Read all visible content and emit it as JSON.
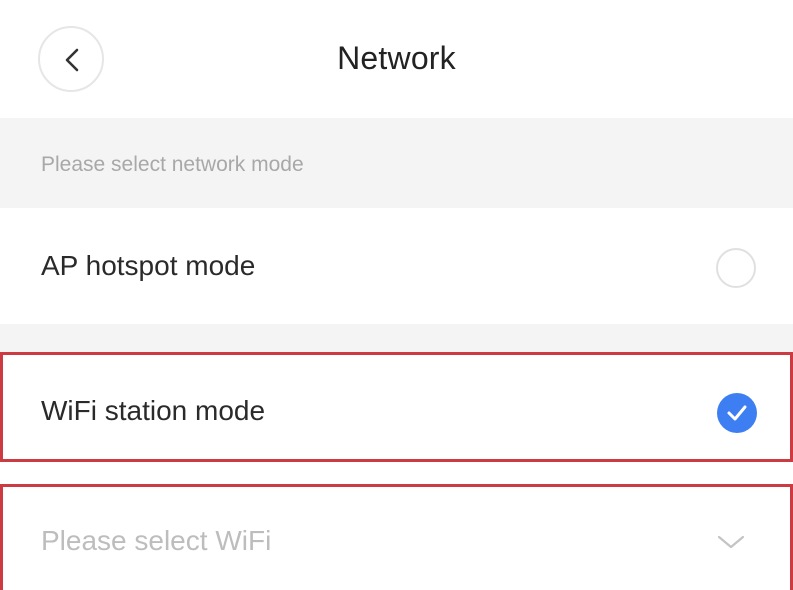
{
  "header": {
    "title": "Network",
    "back_icon": "chevron-left-icon"
  },
  "section": {
    "label": "Please select network mode"
  },
  "options": [
    {
      "label": "AP hotspot mode",
      "selected": false,
      "icon": "radio-unchecked-icon"
    },
    {
      "label": "WiFi station mode",
      "selected": true,
      "icon": "radio-checked-icon"
    }
  ],
  "wifi_select": {
    "placeholder": "Please select WiFi",
    "icon": "chevron-down-icon"
  },
  "colors": {
    "accent": "#3d7ff2",
    "highlight_border": "#cc3b42",
    "section_bg": "#f4f4f4"
  }
}
